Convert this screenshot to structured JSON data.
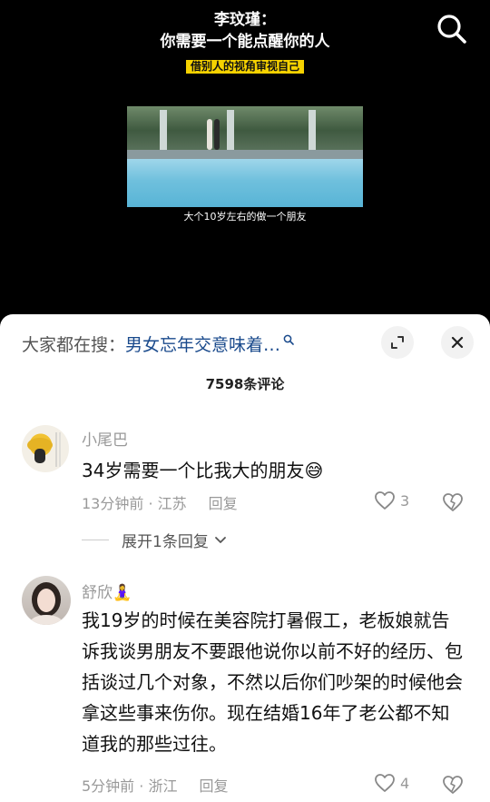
{
  "video": {
    "title_line1": "李玟瑾：",
    "title_line2": "你需要一个能点醒你的人",
    "tag": "借别人的视角审视自己",
    "subtitle": "大个10岁左右的做一个朋友",
    "search_icon": "search-icon"
  },
  "sheet": {
    "search_prefix": "大家都在搜：",
    "search_term": "男女忘年交意味着…",
    "expand_icon": "expand-icon",
    "close_icon": "close-icon",
    "comment_count": "7598条评论"
  },
  "comments": [
    {
      "name": "小尾巴",
      "text": "34岁需要一个比我大的朋友😅",
      "time": "13分钟前 · 江苏",
      "reply_label": "回复",
      "likes": "3",
      "expand_label": "展开1条回复"
    },
    {
      "name": "舒欣🧘‍♀️",
      "text": "我19岁的时候在美容院打暑假工，老板娘就告诉我谈男朋友不要跟他说你以前不好的经历、包括谈过几个对象，不然以后你们吵架的时候他会拿这些事来伤你。现在结婚16年了老公都不知道我的那些过往。",
      "time": "5分钟前 · 浙江",
      "reply_label": "回复",
      "likes": "4"
    }
  ],
  "colors": {
    "tag_bg": "#f6d200",
    "search_term": "#1a4a8c",
    "meta_gray": "#999999"
  }
}
